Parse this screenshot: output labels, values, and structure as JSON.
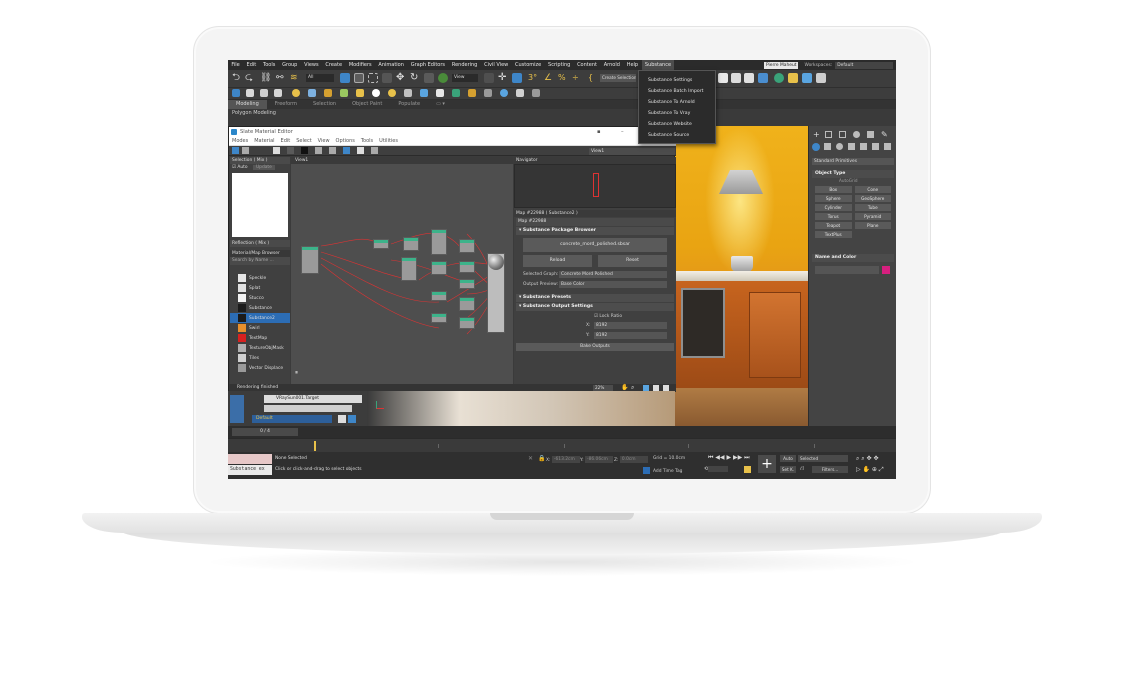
{
  "menubar": {
    "items": [
      "File",
      "Edit",
      "Tools",
      "Group",
      "Views",
      "Create",
      "Modifiers",
      "Animation",
      "Graph Editors",
      "Rendering",
      "Civil View",
      "Customize",
      "Scripting",
      "Content",
      "Arnold",
      "Help",
      "Substance"
    ],
    "user": "Pierre Maheut",
    "workspaces_label": "Workspaces:",
    "workspace_value": "Default"
  },
  "substance_menu": {
    "items": [
      "Substance Settings",
      "Substance Batch Import",
      "Substance To Arnold",
      "Substance To Vray",
      "Substance Website",
      "Substance Source"
    ]
  },
  "toolbar": {
    "all_filter": "All",
    "view_dd": "View",
    "create_selection": "Create Selection S"
  },
  "ribbon": {
    "tabs": [
      "Modeling",
      "Freeform",
      "Selection",
      "Object Paint",
      "Populate"
    ],
    "sub": "Polygon Modeling"
  },
  "slate": {
    "title": "Slate Material Editor",
    "menu": [
      "Modes",
      "Material",
      "Edit",
      "Select",
      "View",
      "Options",
      "Tools",
      "Utilities"
    ],
    "view_dd": "View1",
    "selection_header": "Selection ( Mix )",
    "auto_label": "Auto",
    "update_label": "Update",
    "reflection_header": "Reflection ( Mix )",
    "browser_header": "Material/Map Browser",
    "search_placeholder": "Search by Name ...",
    "view_tab": "View1",
    "materials": [
      {
        "name": "Speckle",
        "color": "#e5e5e5"
      },
      {
        "name": "Splat",
        "color": "#e0e0e0"
      },
      {
        "name": "Stucco",
        "color": "#f2f2f2"
      },
      {
        "name": "Substance",
        "color": "#1b1b1b"
      },
      {
        "name": "Substance2",
        "color": "#1b1b1b"
      },
      {
        "name": "Swirl",
        "color": "#e8902c"
      },
      {
        "name": "TextMap",
        "color": "#d8211f"
      },
      {
        "name": "TextureObjMask",
        "color": "#b0b0b0"
      },
      {
        "name": "Tiles",
        "color": "#cfcfcf"
      },
      {
        "name": "Vector Displace",
        "color": "#9a9a9a"
      }
    ],
    "navigator_header": "Navigator",
    "map_header": "Map #22988 ( Substance2 )",
    "map_name": "Map #22988",
    "package_browser": "Substance Package Browser",
    "package_file": "concrete_mord_polished.sbsar",
    "reload": "Reload",
    "reset": "Reset",
    "selected_graph_label": "Selected Graph:",
    "selected_graph_value": "Concrete Mord Polished",
    "output_preview_label": "Output Preview:",
    "output_preview_value": "Base Color",
    "presets": "Substance Presets",
    "output_settings": "Substance Output Settings",
    "lock_ratio": "Lock Ratio",
    "x_label": "X:",
    "x_value": "8192",
    "y_label": "Y:",
    "y_value": "8192",
    "bake": "Bake Outputs",
    "status": "Rendering finished",
    "zoom": "22%"
  },
  "scene": {
    "target": "VRaySun001.Target",
    "default_layer": "Default"
  },
  "timeline": {
    "frame": "0 / 4"
  },
  "command_panel": {
    "dropdown": "Standard Primitives",
    "object_type": "Object Type",
    "autogrid": "AutoGrid",
    "buttons": [
      "Box",
      "Cone",
      "Sphere",
      "GeoSphere",
      "Cylinder",
      "Tube",
      "Torus",
      "Pyramid",
      "Teapot",
      "Plane",
      "TextPlus"
    ],
    "name_color": "Name and Color"
  },
  "statusbar": {
    "maxscript": "Substance ex",
    "selected": "None Selected",
    "prompt": "Click or click-and-drag to select objects",
    "x_label": "X:",
    "x_value": "-613.2cm",
    "y_label": "Y:",
    "y_value": "-86.06cm",
    "z_label": "Z:",
    "z_value": "0.0cm",
    "grid": "Grid = 10.0cm",
    "add_time_tag": "Add Time Tag",
    "auto": "Auto",
    "selected_dd": "Selected",
    "setk": "Set K.",
    "filters": "Filters..."
  }
}
